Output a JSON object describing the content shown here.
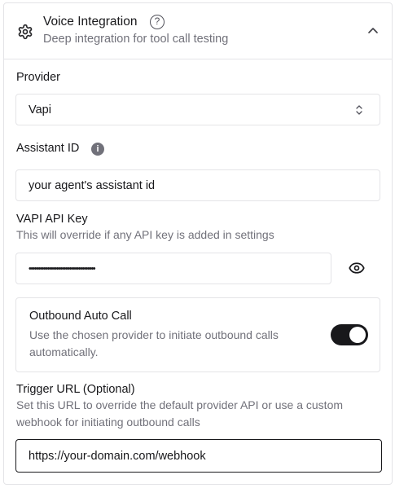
{
  "header": {
    "title": "Voice Integration",
    "help_symbol": "?",
    "subtitle": "Deep integration for tool call testing",
    "gear_icon": "gear-icon",
    "collapse_icon": "chevron-up-icon"
  },
  "provider": {
    "label": "Provider",
    "selected": "Vapi",
    "arrows_icon": "chevrons-up-down-icon"
  },
  "assistant": {
    "label": "Assistant ID",
    "info_symbol": "i",
    "placeholder": "your agent's assistant id"
  },
  "api_key": {
    "label": "VAPI API Key",
    "hint": "This will override if any API key is added in settings",
    "masked_value": "••••••••••••••••••••••••••••••••••••",
    "eye_icon": "eye-icon"
  },
  "outbound": {
    "title": "Outbound Auto Call",
    "description": "Use the chosen provider to initiate outbound calls automatically.",
    "enabled": true
  },
  "trigger": {
    "label": "Trigger URL (Optional)",
    "hint": "Set this URL to override the default provider API or use a custom webhook for initiating outbound calls",
    "value": "https://your-domain.com/webhook"
  },
  "colors": {
    "border": "#e4e4e7",
    "text": "#18181b",
    "muted": "#71717a",
    "toggle_on": "#18181b"
  }
}
